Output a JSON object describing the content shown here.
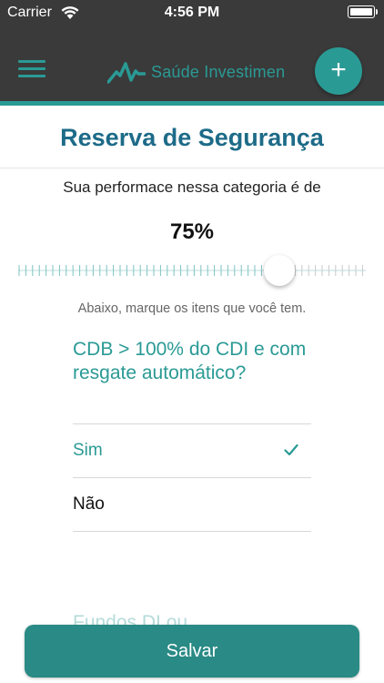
{
  "status_bar": {
    "carrier": "Carrier",
    "time": "4:56 PM"
  },
  "nav": {
    "logo_text": "Saúde Investimen",
    "add_icon": "plus-icon",
    "menu_icon": "hamburger-icon"
  },
  "page": {
    "title": "Reserva de Segurança",
    "subtitle": "Sua performace nessa categoria é de",
    "performance": "75%",
    "slider_value": 0.75,
    "hint": "Abaixo, marque os itens que você tem."
  },
  "question": {
    "text": "CDB > 100% do CDI e com resgate automático?",
    "options": [
      {
        "label": "Sim",
        "selected": true
      },
      {
        "label": "Não",
        "selected": false
      }
    ]
  },
  "next_question_partial": "Fundos DI ou...",
  "actions": {
    "save_label": "Salvar"
  },
  "colors": {
    "accent": "#2a9a95",
    "title": "#1d6b88",
    "header_bg": "#3a3a3a",
    "button_bg": "#2a8a85"
  }
}
